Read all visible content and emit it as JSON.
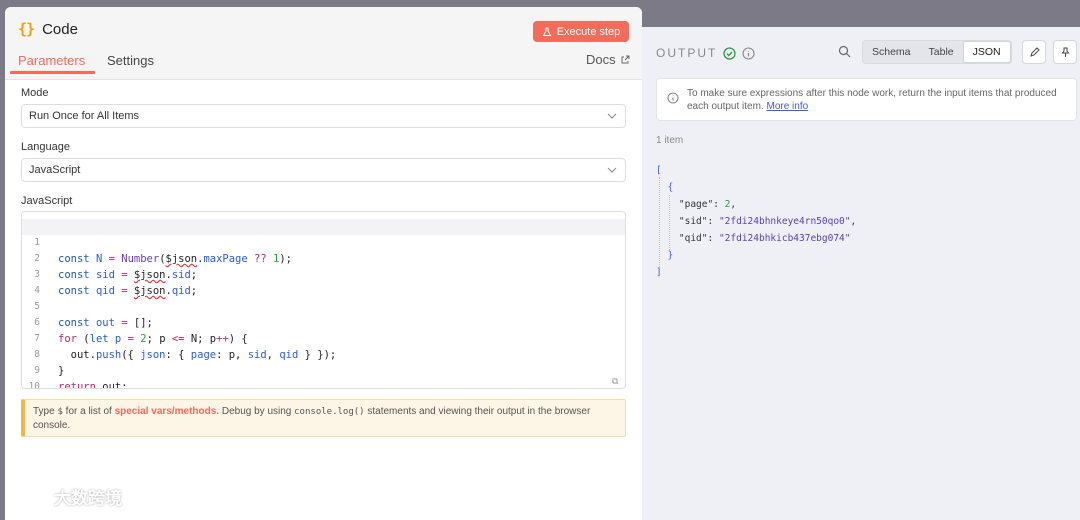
{
  "node": {
    "icon": "{}",
    "title": "Code",
    "execute_label": "Execute step"
  },
  "tabs": [
    {
      "label": "Parameters",
      "active": true
    },
    {
      "label": "Settings",
      "active": false
    }
  ],
  "docs_label": "Docs",
  "mode": {
    "label": "Mode",
    "value": "Run Once for All Items"
  },
  "language": {
    "label": "Language",
    "value": "JavaScript"
  },
  "editor": {
    "label": "JavaScript",
    "line_numbers": [
      "1",
      "2",
      "3",
      "4",
      "5",
      "6",
      "7",
      "8",
      "9",
      "10"
    ],
    "lines": [
      "const N = Number($json.maxPage ?? 1);",
      "const sid = $json.sid;",
      "const qid = $json.qid;",
      "",
      "const out = [];",
      "for (let p = 2; p <= N; p++) {",
      "  out.push({ json: { page: p, sid, qid } });",
      "}",
      "return out;",
      ""
    ]
  },
  "hint": {
    "prefix": "Type ",
    "dollar": "$",
    "mid1": " for a list of ",
    "special": "special vars/methods.",
    "mid2": " Debug by using ",
    "console_code": "console.log()",
    "suffix": " statements and viewing their output in the browser console."
  },
  "output": {
    "title": "OUTPUT",
    "views": [
      "Schema",
      "Table",
      "JSON"
    ],
    "active_view": "JSON",
    "notice_text": "To make sure expressions after this node work, return the input items that produced each output item.",
    "notice_link": "More info",
    "item_count": "1 item",
    "json": {
      "open_bracket": "[",
      "open_brace": "{",
      "entries": [
        {
          "key": "\"page\"",
          "value": "2",
          "type": "number"
        },
        {
          "key": "\"sid\"",
          "value": "\"2fdi24bhnkeye4rn50qo0\"",
          "type": "string"
        },
        {
          "key": "\"qid\"",
          "value": "\"2fdi24bhkicb437ebg074\"",
          "type": "string"
        }
      ],
      "close_brace": "}",
      "close_bracket": "]"
    }
  },
  "watermark": "大数跨境",
  "colors": {
    "accent": "#f36b5a",
    "json_string": "#5d3fb5",
    "json_number": "#2e9e44",
    "keyword": "#1d5bb8"
  }
}
